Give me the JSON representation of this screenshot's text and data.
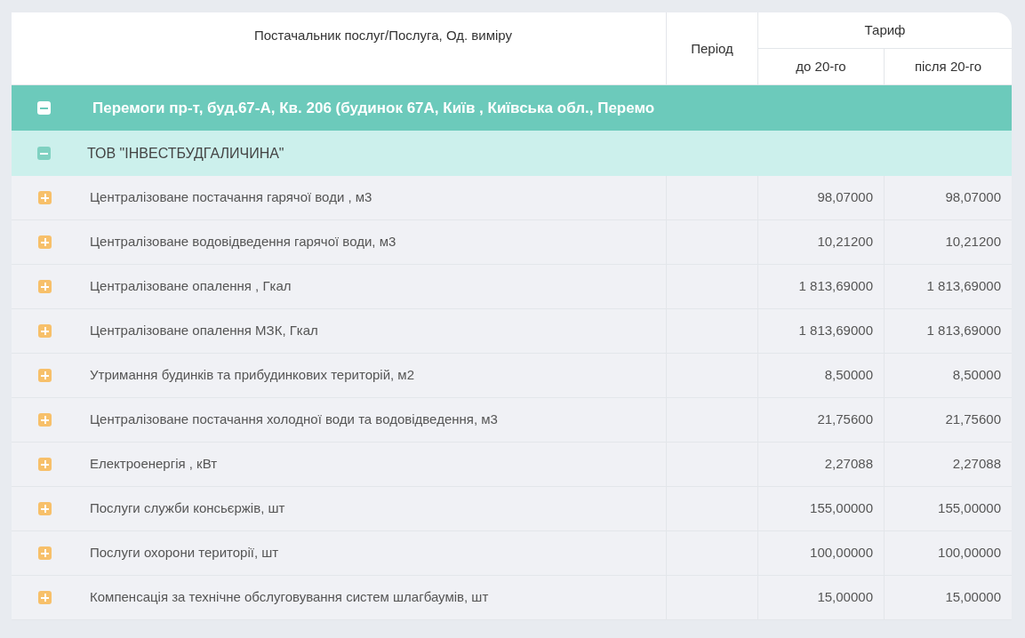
{
  "table": {
    "columns": {
      "service": "Постачальник послуг/Послуга, Од. виміру",
      "period": "Період",
      "tariff": {
        "label": "Тариф",
        "before": "до 20-го",
        "after": "після 20-го"
      }
    },
    "groups": [
      {
        "label": "Перемоги пр-т, буд.67-А, Кв. 206 (будинок 67А, Київ , Київська обл., Перемо",
        "expanded": true,
        "suppliers": [
          {
            "label": "ТОВ \"ІНВЕСТБУДГАЛИЧИНА\"",
            "expanded": true,
            "rows": [
              {
                "service": "Централізоване постачання гарячої води , м3",
                "expanded": false,
                "before": "98,07000",
                "after": "98,07000"
              },
              {
                "service": "Централізоване водовідведення гарячої води, м3",
                "expanded": false,
                "before": "10,21200",
                "after": "10,21200"
              },
              {
                "service": "Централізоване опалення , Гкал",
                "expanded": false,
                "before": "1 813,69000",
                "after": "1 813,69000"
              },
              {
                "service": "Централізоване опалення МЗК, Гкал",
                "expanded": false,
                "before": "1 813,69000",
                "after": "1 813,69000"
              },
              {
                "service": "Утримання будинків та прибудинкових територій, м2",
                "expanded": false,
                "before": "8,50000",
                "after": "8,50000"
              },
              {
                "service": "Централізоване постачання холодної води та водовідведення, м3",
                "expanded": false,
                "before": "21,75600",
                "after": "21,75600"
              },
              {
                "service": "Електроенергія , кВт",
                "expanded": false,
                "before": "2,27088",
                "after": "2,27088"
              },
              {
                "service": "Послуги служби консьєржів, шт",
                "expanded": false,
                "before": "155,00000",
                "after": "155,00000"
              },
              {
                "service": "Послуги охорони території, шт",
                "expanded": false,
                "before": "100,00000",
                "after": "100,00000"
              },
              {
                "service": "Компенсація за технічне обслуговування систем шлагбаумів, шт",
                "expanded": false,
                "before": "15,00000",
                "after": "15,00000"
              }
            ]
          }
        ]
      }
    ]
  }
}
